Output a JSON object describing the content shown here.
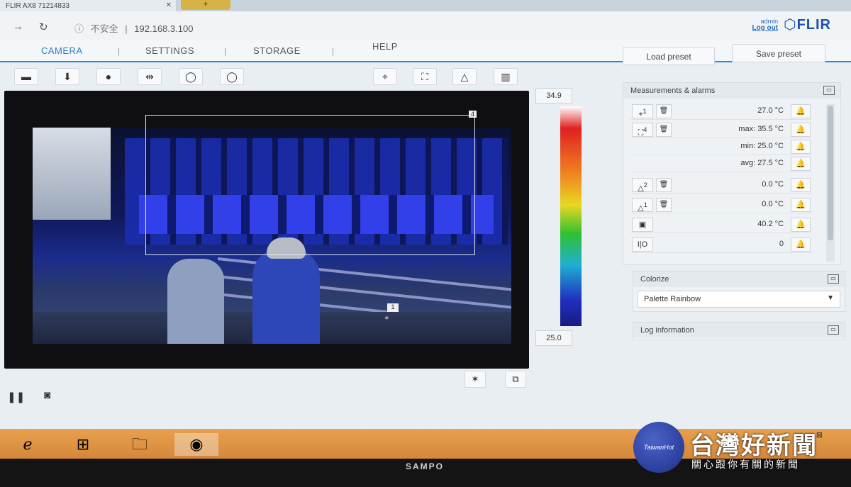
{
  "browser": {
    "tab_title": "FLIR AX8 71214833",
    "url_warning": "不安全",
    "url": "192.168.3.100"
  },
  "header": {
    "user": "admin",
    "logout": "Log out",
    "logo": "FLIR"
  },
  "nav": {
    "tabs": [
      "CAMERA",
      "SETTINGS",
      "STORAGE",
      "HELP"
    ],
    "active": "CAMERA"
  },
  "presets": {
    "load": "Load preset",
    "save": "Save preset"
  },
  "scale": {
    "max": "34.9",
    "min": "25.0"
  },
  "overlay": {
    "box_id": "4",
    "spot_id": "1"
  },
  "measurements": {
    "title": "Measurements & alarms",
    "spot": {
      "id": "1",
      "value": "27.0 °C"
    },
    "box": {
      "id": "4",
      "max": "max: 35.5 °C",
      "min": "min: 25.0 °C",
      "avg": "avg: 27.5 °C"
    },
    "delta2": {
      "id": "2",
      "value": "0.0 °C"
    },
    "delta1": {
      "id": "1",
      "value": "0.0 °C"
    },
    "internal": {
      "value": "40.2 °C"
    },
    "io": {
      "label": "I|O",
      "value": "0"
    }
  },
  "colorize": {
    "title": "Colorize",
    "selected": "Palette Rainbow"
  },
  "log": {
    "title": "Log information"
  },
  "bezel": {
    "maker": "SAMPO"
  },
  "watermark": {
    "title": "台灣好新聞",
    "subtitle": "關心跟你有關的新聞",
    "badge": "TaiwanHot"
  }
}
